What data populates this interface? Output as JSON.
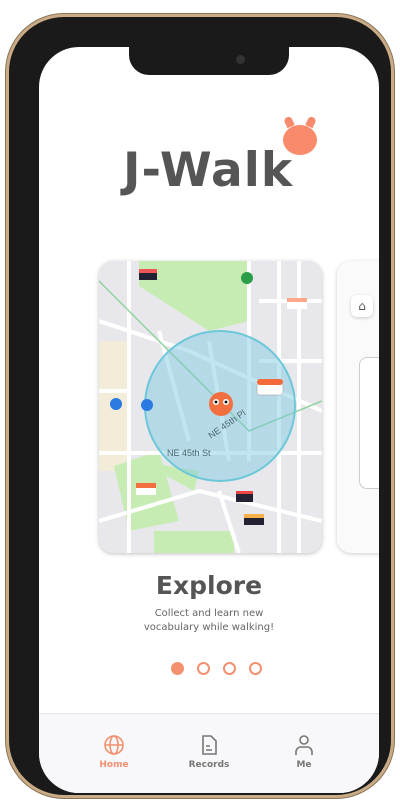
{
  "app": {
    "logo": "J-Walk"
  },
  "carousel": {
    "title": "Explore",
    "description_line1": "Collect and learn new",
    "description_line2": "vocabulary while walking!",
    "page_count": 4,
    "active_page": 1
  },
  "map": {
    "street1": "NE 45th Pl",
    "street2": "NE 45th St"
  },
  "tabs": [
    {
      "label": "Home",
      "icon": "globe-icon",
      "active": true
    },
    {
      "label": "Records",
      "icon": "document-icon"
    },
    {
      "label": "Me",
      "icon": "person-icon"
    }
  ],
  "colors": {
    "accent": "#f3906f",
    "text": "#555555"
  }
}
